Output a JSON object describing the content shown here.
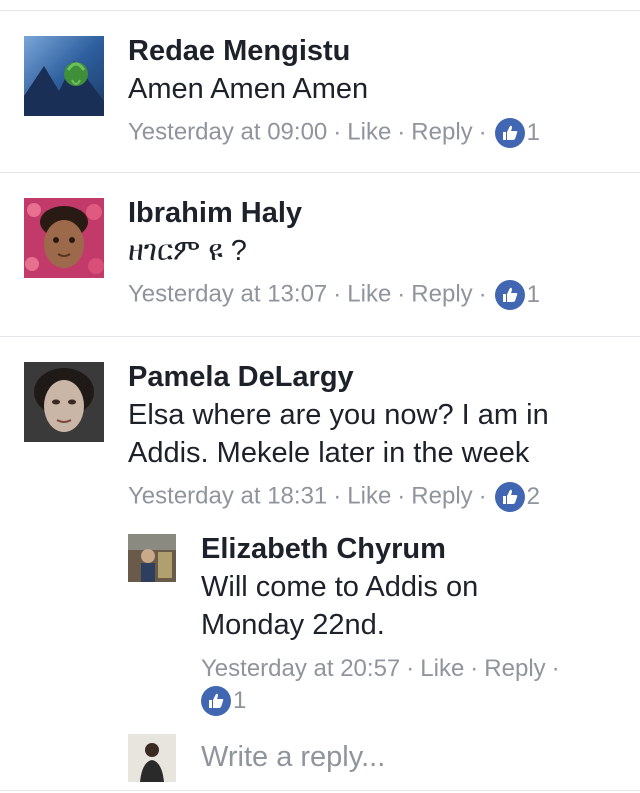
{
  "comments": [
    {
      "author": "Redae Mengistu",
      "text": "Amen Amen Amen",
      "timestamp": "Yesterday at 09:00",
      "like_label": "Like",
      "reply_label": "Reply",
      "reactions": "1",
      "avatar_icon": "landscape-avatar-icon"
    },
    {
      "author": "Ibrahim Haly",
      "text": "ዘገርም ዩ ?",
      "timestamp": "Yesterday at 13:07",
      "like_label": "Like",
      "reply_label": "Reply",
      "reactions": "1",
      "avatar_icon": "child-photo-avatar-icon"
    },
    {
      "author": "Pamela DeLargy",
      "text": "Elsa where are you now? I am in Addis. Mekele later in the week",
      "timestamp": "Yesterday at 18:31",
      "like_label": "Like",
      "reply_label": "Reply",
      "reactions": "2",
      "avatar_icon": "portrait-avatar-icon"
    }
  ],
  "reply": {
    "author": "Elizabeth Chyrum",
    "text": "Will come to Addis on Monday 22nd.",
    "timestamp": "Yesterday at 20:57",
    "like_label": "Like",
    "reply_label": "Reply",
    "reactions": "1"
  },
  "reply_box": {
    "placeholder": "Write a reply..."
  },
  "separator": "·",
  "colors": {
    "like_badge": "#4267b2",
    "meta_text": "#90949c",
    "name_text": "#1d2129",
    "divider": "#e4e6eb"
  }
}
